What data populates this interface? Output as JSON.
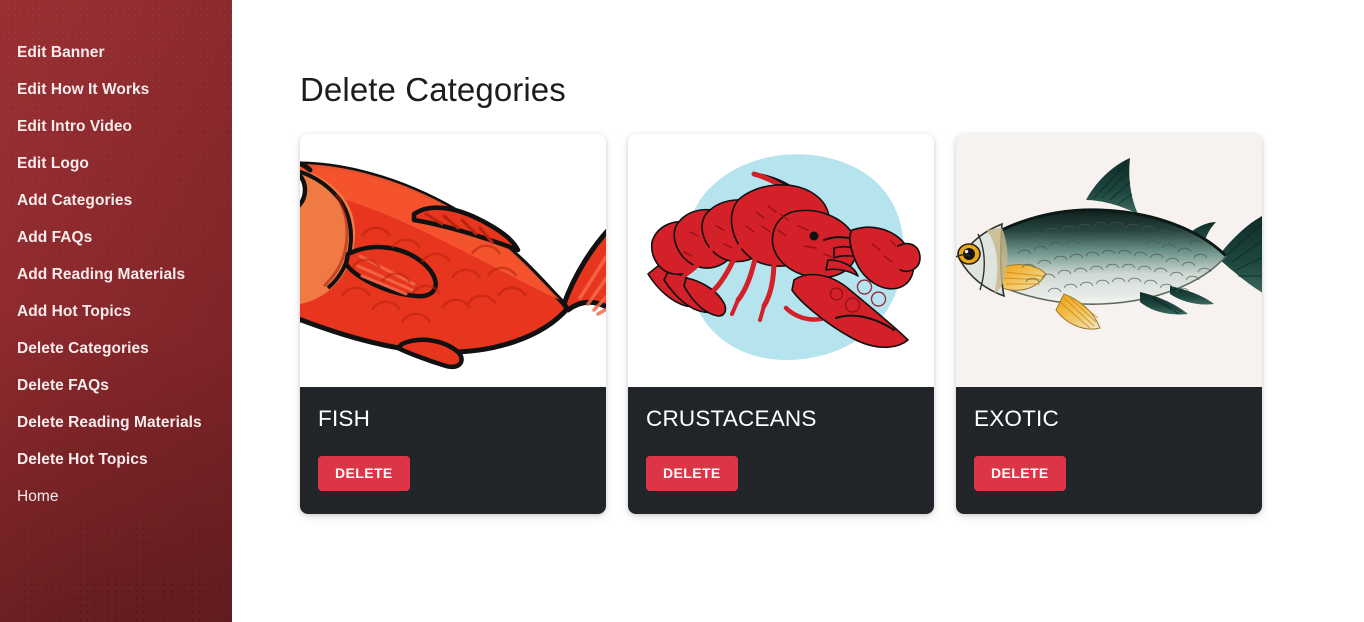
{
  "sidebar": {
    "background_color": "#8e2a2e",
    "items": [
      {
        "label": "Edit Banner",
        "weight": "bold"
      },
      {
        "label": "Edit How It Works",
        "weight": "bold"
      },
      {
        "label": "Edit Intro Video",
        "weight": "bold"
      },
      {
        "label": "Edit Logo",
        "weight": "bold"
      },
      {
        "label": "Add Categories",
        "weight": "bold"
      },
      {
        "label": "Add FAQs",
        "weight": "bold"
      },
      {
        "label": "Add Reading Materials",
        "weight": "bold"
      },
      {
        "label": "Add Hot Topics",
        "weight": "bold"
      },
      {
        "label": "Delete Categories",
        "weight": "bold"
      },
      {
        "label": "Delete FAQs",
        "weight": "bold"
      },
      {
        "label": "Delete Reading Materials",
        "weight": "bold"
      },
      {
        "label": "Delete Hot Topics",
        "weight": "bold"
      },
      {
        "label": "Home",
        "weight": "regular"
      }
    ]
  },
  "main": {
    "page_title": "Delete Categories",
    "card_body_color": "#212529",
    "delete_button_color": "#dc3545",
    "cards": [
      {
        "title": "FISH",
        "delete_label": "DELETE",
        "image_name": "red-cartoon-fish-sticker",
        "image_background": "#ffffff"
      },
      {
        "title": "CRUSTACEANS",
        "delete_label": "DELETE",
        "image_name": "red-crayfish-illustration",
        "image_background": "#ffffff",
        "image_blob_color": "#b5e4ee"
      },
      {
        "title": "EXOTIC",
        "delete_label": "DELETE",
        "image_name": "vintage-green-fish-illustration",
        "image_background": "#f7f2f0"
      }
    ]
  }
}
